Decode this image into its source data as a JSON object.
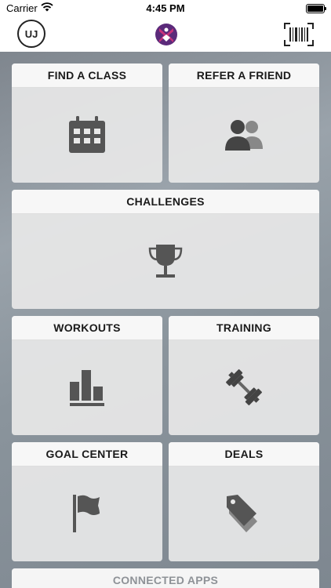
{
  "status_bar": {
    "carrier": "Carrier",
    "time": "4:45 PM"
  },
  "nav": {
    "avatar_initials": "UJ"
  },
  "tiles": {
    "find_class": "FIND A CLASS",
    "refer_friend": "REFER A FRIEND",
    "challenges": "CHALLENGES",
    "workouts": "WORKOUTS",
    "training": "TRAINING",
    "goal_center": "GOAL CENTER",
    "deals": "DEALS",
    "connected_apps": "CONNECTED APPS"
  },
  "colors": {
    "icon": "#555555",
    "logo_pink": "#c8327a",
    "logo_purple": "#5b2a7a"
  }
}
